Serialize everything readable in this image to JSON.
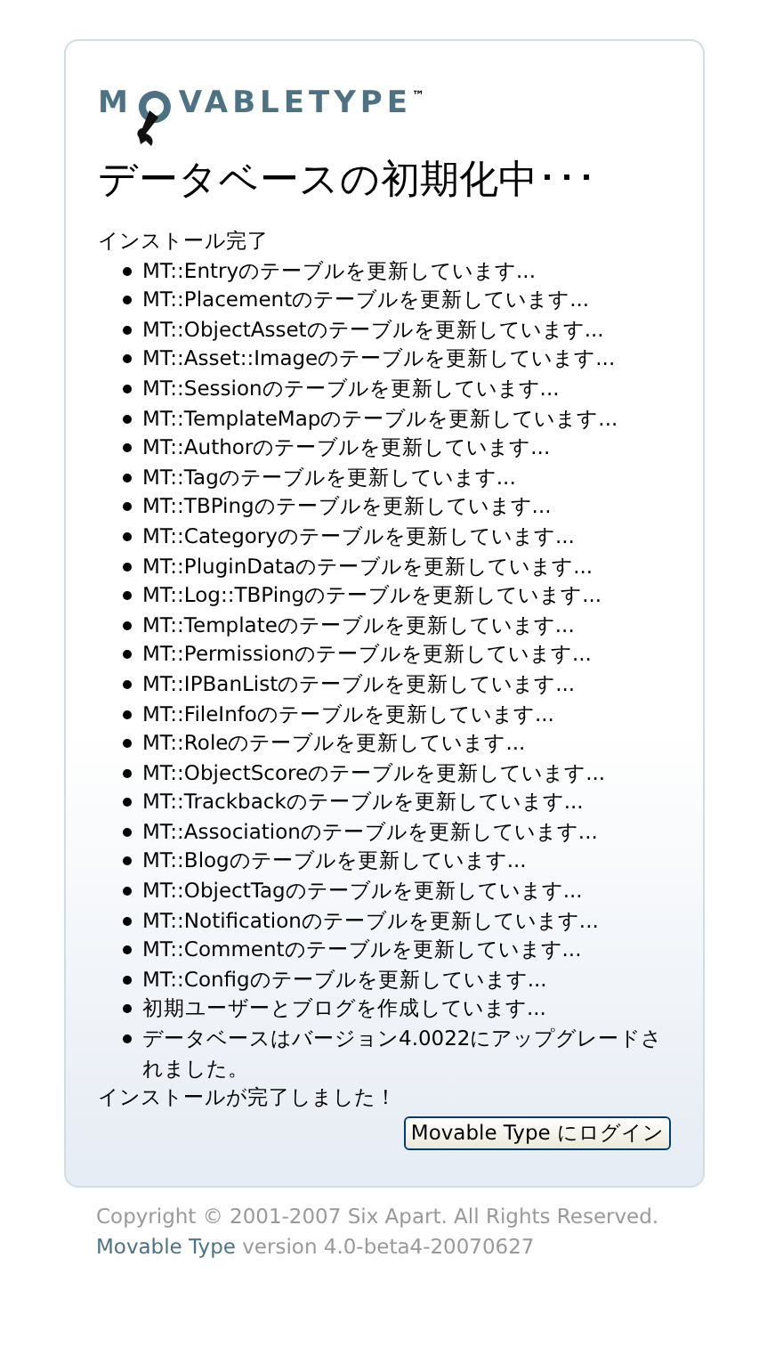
{
  "logo": {
    "before": "M",
    "after": "VABLETYPE",
    "mark": "™"
  },
  "title": "データベースの初期化中･･･",
  "intro": "インストール完了",
  "steps": [
    "MT::Entryのテーブルを更新しています...",
    "MT::Placementのテーブルを更新しています...",
    "MT::ObjectAssetのテーブルを更新しています...",
    "MT::Asset::Imageのテーブルを更新しています...",
    "MT::Sessionのテーブルを更新しています...",
    "MT::TemplateMapのテーブルを更新しています...",
    "MT::Authorのテーブルを更新しています...",
    "MT::Tagのテーブルを更新しています...",
    "MT::TBPingのテーブルを更新しています...",
    "MT::Categoryのテーブルを更新しています...",
    "MT::PluginDataのテーブルを更新しています...",
    "MT::Log::TBPingのテーブルを更新しています...",
    "MT::Templateのテーブルを更新しています...",
    "MT::Permissionのテーブルを更新しています...",
    "MT::IPBanListのテーブルを更新しています...",
    "MT::FileInfoのテーブルを更新しています...",
    "MT::Roleのテーブルを更新しています...",
    "MT::ObjectScoreのテーブルを更新しています...",
    "MT::Trackbackのテーブルを更新しています...",
    "MT::Associationのテーブルを更新しています...",
    "MT::Blogのテーブルを更新しています...",
    "MT::ObjectTagのテーブルを更新しています...",
    "MT::Notificationのテーブルを更新しています...",
    "MT::Commentのテーブルを更新しています...",
    "MT::Configのテーブルを更新しています...",
    "初期ユーザーとブログを作成しています...",
    "データベースはバージョン4.0022にアップグレードされました。"
  ],
  "done": "インストールが完了しました！",
  "login_button": "Movable Type にログイン",
  "footer": {
    "copyright": "Copyright © 2001-2007 Six Apart. All Rights Reserved.",
    "product_link": "Movable Type",
    "version": "version 4.0-beta4-20070627"
  }
}
